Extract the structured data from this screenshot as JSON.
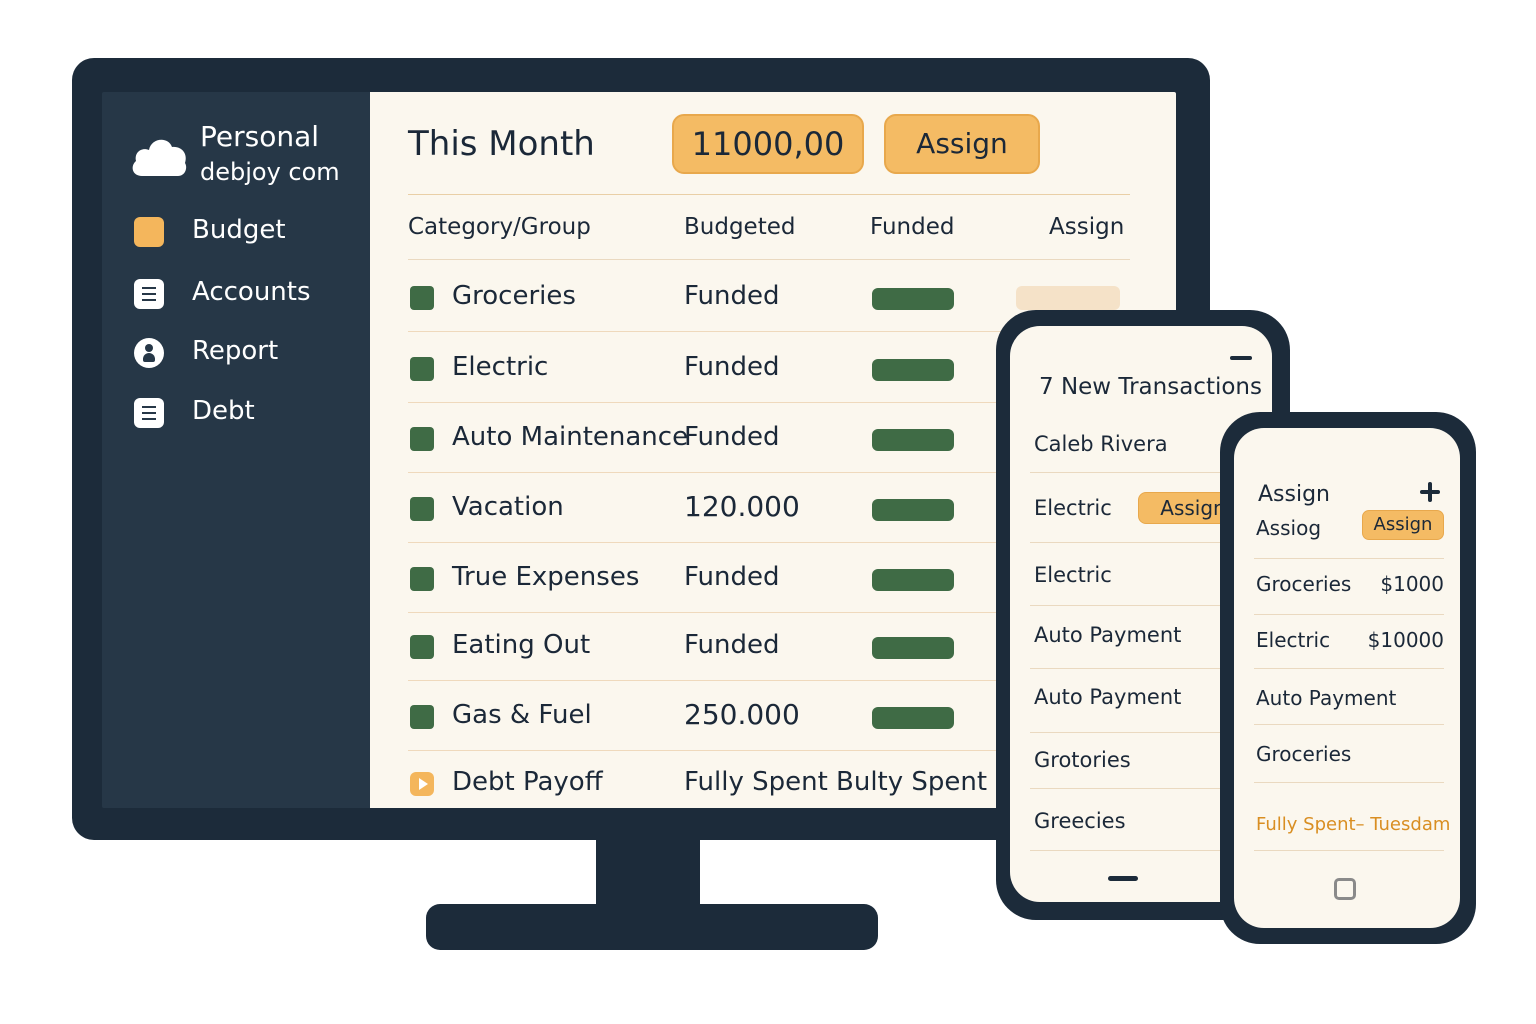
{
  "sidebar": {
    "brand_name": "Personal",
    "brand_sub": "debjoy com",
    "items": [
      {
        "label": "Budget",
        "icon": "square-icon"
      },
      {
        "label": "Accounts",
        "icon": "document-icon"
      },
      {
        "label": "Report",
        "icon": "person-icon"
      },
      {
        "label": "Debt",
        "icon": "document-icon"
      }
    ]
  },
  "header": {
    "title": "This Month",
    "total": "11000,00",
    "assign_label": "Assign"
  },
  "table": {
    "columns": [
      "Category/Group",
      "Budgeted",
      "Funded",
      "Assign"
    ],
    "rows": [
      {
        "name": "Groceries",
        "budgeted": "Funded",
        "funded": 1
      },
      {
        "name": "Electric",
        "budgeted": "Funded",
        "funded": 1
      },
      {
        "name": "Auto Maintenance",
        "budgeted": "Funded",
        "funded": 1
      },
      {
        "name": "Vacation",
        "budgeted": "120.000",
        "funded": 1
      },
      {
        "name": "True Expenses",
        "budgeted": "Funded",
        "funded": 1
      },
      {
        "name": "Eating Out",
        "budgeted": "Funded",
        "funded": 1
      },
      {
        "name": "Gas & Fuel",
        "budgeted": "250.000",
        "funded": 1
      },
      {
        "name": "Debt Payoff",
        "budgeted": "Fully Spent",
        "funded_text": "Bulty Spent"
      }
    ]
  },
  "phone1": {
    "title": "7 New Transactions",
    "payee": "Caleb Rivera",
    "assign_item": "Electric",
    "assign_label": "Assign",
    "items": [
      "Electric",
      "Auto Payment",
      "Auto Payment",
      "Grotories",
      "Greecies"
    ]
  },
  "phone2": {
    "title": "Assign",
    "assign_row_label": "Assiog",
    "assign_label": "Assign",
    "items": [
      {
        "label": "Groceries",
        "amount": "$1000"
      },
      {
        "label": "Electric",
        "amount": "$10000"
      },
      {
        "label": "Auto Payment",
        "amount": ""
      },
      {
        "label": "Groceries",
        "amount": ""
      }
    ],
    "accent_text": "Fully Spent– Tuesdam"
  },
  "colors": {
    "dark_navy": "#1c2b3a",
    "sidebar": "#263747",
    "accent_orange": "#f4bb64",
    "funded_green": "#3f6b45",
    "background_cream": "#fbf7ee"
  }
}
